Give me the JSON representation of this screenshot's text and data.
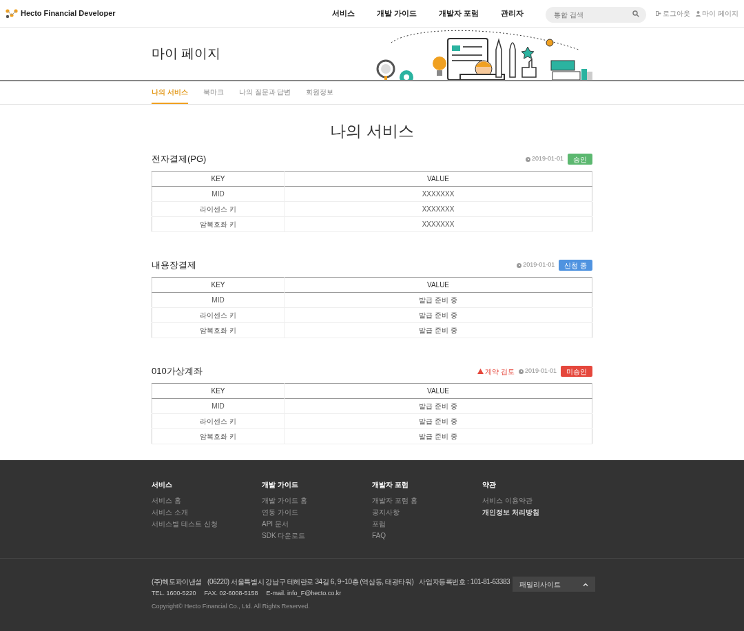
{
  "header": {
    "logo": "Hecto Financial Developer",
    "nav": [
      "서비스",
      "개발 가이드",
      "개발자 포럼",
      "관리자"
    ],
    "search": {
      "placeholder": "통합 검색"
    },
    "links": [
      {
        "kind": "logout",
        "label": "로그아웃"
      },
      {
        "kind": "user",
        "label": "마이 페이지"
      }
    ]
  },
  "page_title": "마이 페이지",
  "tabs": [
    {
      "label": "나의 서비스",
      "selected": true
    },
    {
      "label": "북마크",
      "selected": false
    },
    {
      "label": "나의 질문과 답변",
      "selected": false
    },
    {
      "label": "회원정보",
      "selected": false
    }
  ],
  "heading": "나의 서비스",
  "services": [
    {
      "title": "전자결제(PG)",
      "date": "2019-01-01",
      "status": {
        "kind": "approved",
        "label": "승인"
      },
      "columns": [
        "KEY",
        "VALUE"
      ],
      "rows": [
        [
          "MID",
          "XXXXXXX"
        ],
        [
          "라이센스 키",
          "XXXXXXX"
        ],
        [
          "암복호화 키",
          "XXXXXXX"
        ]
      ]
    },
    {
      "title": "내용장결제",
      "date": "2019-01-01",
      "status": {
        "kind": "pending",
        "label": "신청 중"
      },
      "columns": [
        "KEY",
        "VALUE"
      ],
      "rows": [
        [
          "MID",
          "발급 준비 중"
        ],
        [
          "라이센스 키",
          "발급 준비 중"
        ],
        [
          "암복호화 키",
          "발급 준비 중"
        ]
      ]
    },
    {
      "title": "010가상계좌",
      "warning": "계약 검토",
      "date": "2019-01-01",
      "status": {
        "kind": "rejected",
        "label": "미승인"
      },
      "columns": [
        "KEY",
        "VALUE"
      ],
      "rows": [
        [
          "MID",
          "발급 준비 중"
        ],
        [
          "라이센스 키",
          "발급 준비 중"
        ],
        [
          "암복호화 키",
          "발급 준비 중"
        ]
      ]
    }
  ],
  "footer": {
    "columns": [
      {
        "title": "서비스",
        "links": [
          {
            "label": "서비스 홈",
            "bold": false
          },
          {
            "label": "서비스 소개",
            "bold": false
          },
          {
            "label": "서비스별 테스트 신청",
            "bold": false
          }
        ]
      },
      {
        "title": "개발 가이드",
        "links": [
          {
            "label": "개발 가이드 홈",
            "bold": false
          },
          {
            "label": "연동 가이드",
            "bold": false
          },
          {
            "label": "API 문서",
            "bold": false
          },
          {
            "label": "SDK 다운로드",
            "bold": false
          }
        ]
      },
      {
        "title": "개발자 포럼",
        "links": [
          {
            "label": "개발자 포럼 홈",
            "bold": false
          },
          {
            "label": "공지사항",
            "bold": false
          },
          {
            "label": "포럼",
            "bold": false
          },
          {
            "label": "FAQ",
            "bold": false
          }
        ]
      },
      {
        "title": "약관",
        "links": [
          {
            "label": "서비스 이용약관",
            "bold": false
          },
          {
            "label": "개인정보 처리방침",
            "bold": true
          }
        ]
      }
    ],
    "info_line1": [
      "(주)헥토파이낸셜",
      "(06220) 서울특별시 강남구 테헤란로 34길 6, 9~10층 (역삼동, 태광타워)",
      "사업자등록번호 : 101-81-63383"
    ],
    "info_line2": [
      "TEL. 1600-5220",
      "FAX. 02-6008-5158",
      "E-mail. info_F@hecto.co.kr"
    ],
    "copyright": "Copyright© Hecto Financial Co., Ltd. All Rights Reserved.",
    "family_site": "패밀리사이트"
  }
}
